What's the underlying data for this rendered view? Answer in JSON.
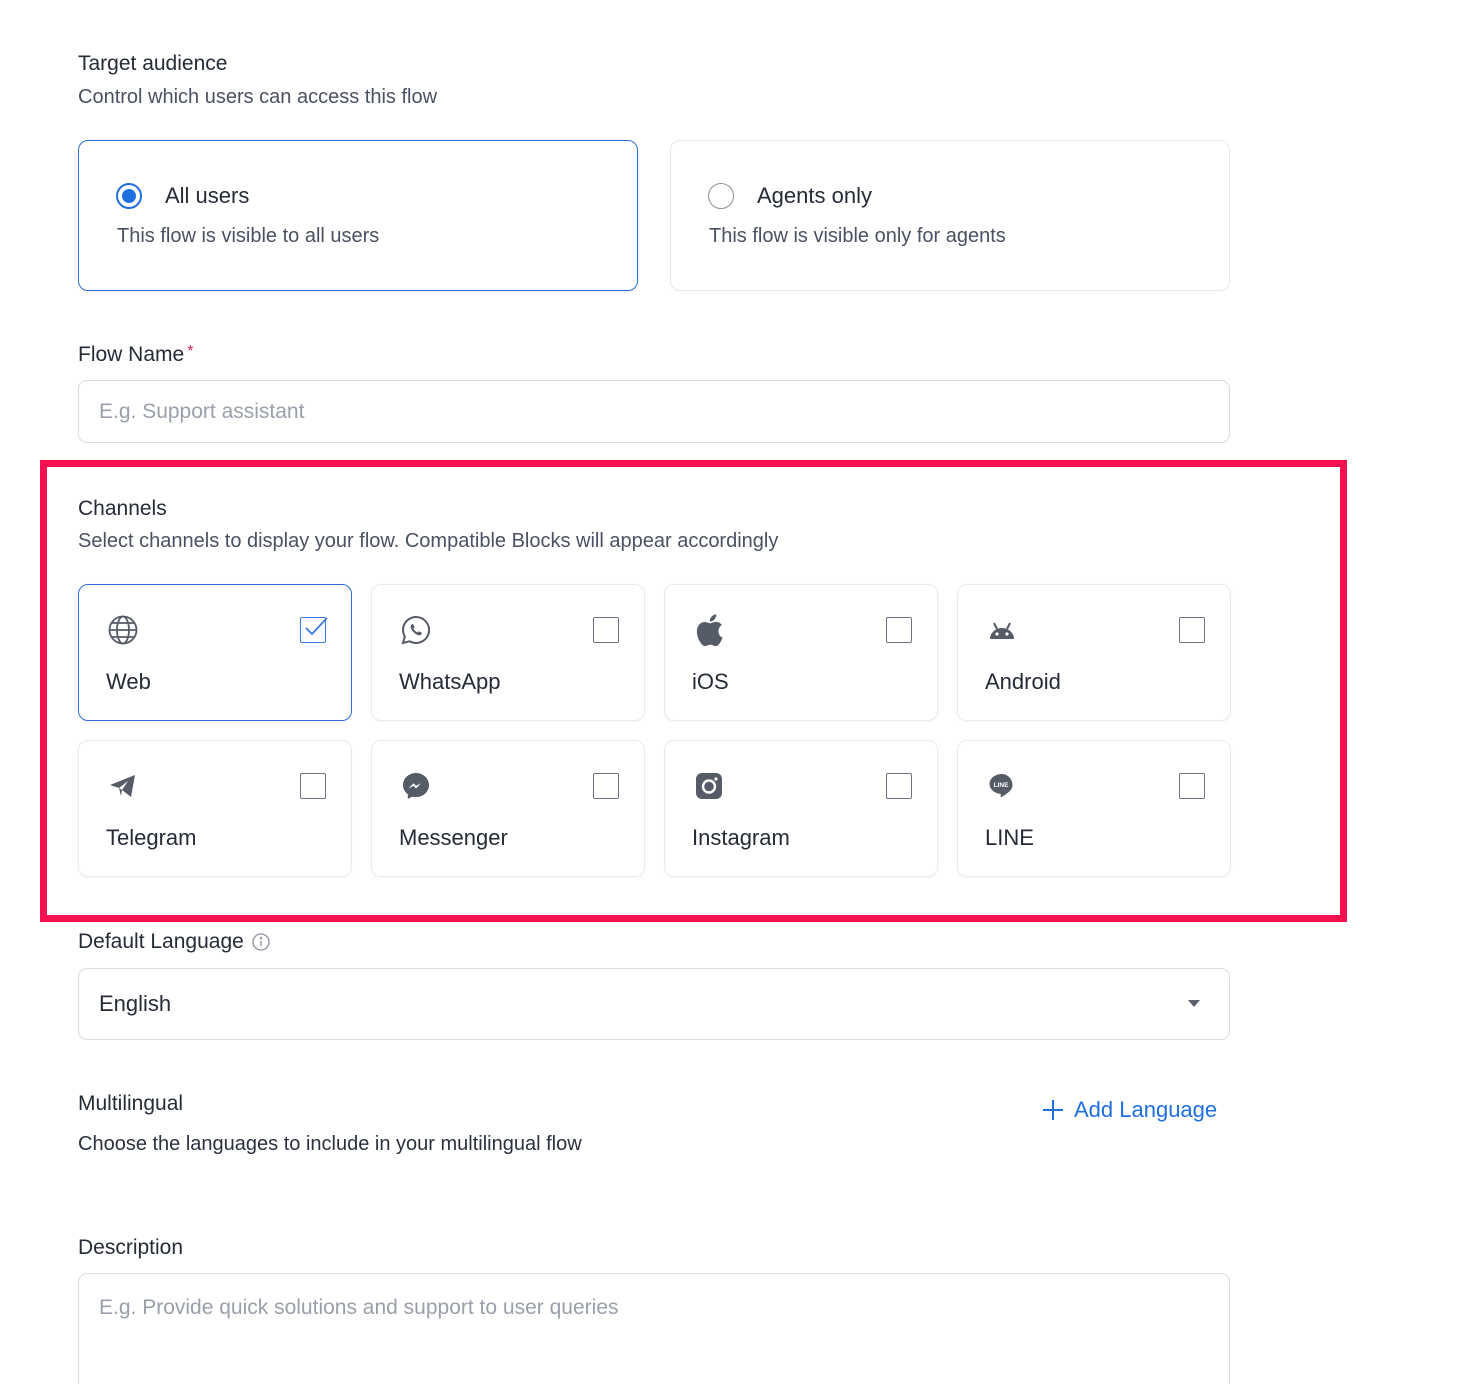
{
  "target_audience": {
    "title": "Target audience",
    "subtitle": "Control which users can access this flow",
    "options": [
      {
        "title": "All users",
        "description": "This flow is visible to all users",
        "selected": true
      },
      {
        "title": "Agents only",
        "description": "This flow is visible only for agents",
        "selected": false
      }
    ]
  },
  "flow_name": {
    "label": "Flow Name",
    "required_mark": "*",
    "placeholder": "E.g. Support assistant",
    "value": ""
  },
  "channels": {
    "title": "Channels",
    "subtitle": "Select channels to display your flow. Compatible Blocks will appear accordingly",
    "items": [
      {
        "label": "Web",
        "icon": "globe-icon",
        "checked": true
      },
      {
        "label": "WhatsApp",
        "icon": "whatsapp-icon",
        "checked": false
      },
      {
        "label": "iOS",
        "icon": "apple-icon",
        "checked": false
      },
      {
        "label": "Android",
        "icon": "android-icon",
        "checked": false
      },
      {
        "label": "Telegram",
        "icon": "telegram-icon",
        "checked": false
      },
      {
        "label": "Messenger",
        "icon": "messenger-icon",
        "checked": false
      },
      {
        "label": "Instagram",
        "icon": "instagram-icon",
        "checked": false
      },
      {
        "label": "LINE",
        "icon": "line-icon",
        "checked": false
      }
    ]
  },
  "default_language": {
    "label": "Default Language",
    "value": "English",
    "info_icon": "info-icon"
  },
  "multilingual": {
    "title": "Multilingual",
    "subtitle": "Choose the languages to include in your multilingual flow",
    "add_label": "Add Language"
  },
  "description": {
    "label": "Description",
    "placeholder": "E.g. Provide quick solutions and support to user queries",
    "value": ""
  },
  "colors": {
    "accent": "#1f6fe0",
    "highlight": "#f5104f",
    "icon": "#555b67"
  }
}
